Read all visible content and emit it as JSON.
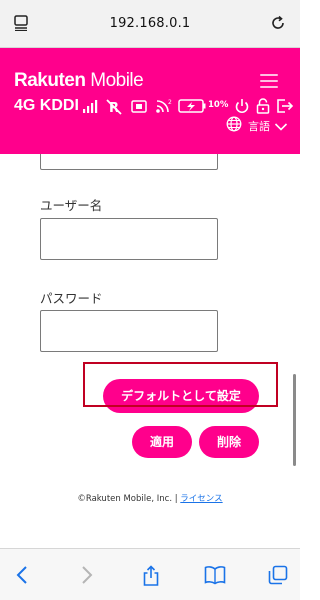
{
  "browser": {
    "url": "192.168.0.1"
  },
  "header": {
    "brand_main": "Rakuten",
    "brand_sub": "Mobile",
    "carrier": "4G KDDI",
    "battery_percent": "10%",
    "language_label": "言語",
    "background_color": "#ff008c"
  },
  "form": {
    "username_label": "ユーザー名",
    "username_value": "",
    "password_label": "パスワード",
    "password_value": "",
    "default_button": "デフォルトとして設定",
    "apply_button": "適用",
    "delete_button": "削除"
  },
  "footer": {
    "copyright": "©Rakuten Mobile, Inc. | ",
    "license_link": "ライセンス"
  },
  "colors": {
    "accent": "#ff008c",
    "highlight_box": "#c00022",
    "link": "#1a73e8"
  },
  "icons": {
    "urlbar": [
      "reader-icon",
      "reload-icon"
    ],
    "status": [
      "signal-bars-icon",
      "no-roaming-icon",
      "sim-card-icon",
      "wifi-icon",
      "battery-icon",
      "power-icon",
      "lock-icon",
      "logout-icon",
      "globe-icon",
      "chevron-down-icon"
    ],
    "toolbar": [
      "back-icon",
      "forward-icon",
      "share-icon",
      "bookmarks-icon",
      "tabs-icon"
    ]
  }
}
